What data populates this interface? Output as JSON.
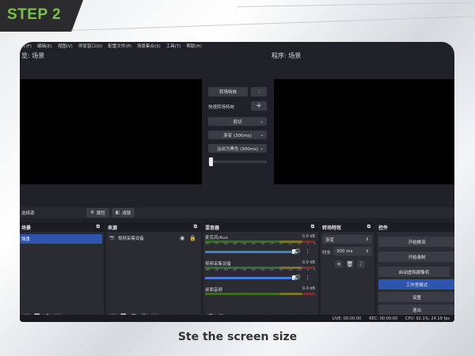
{
  "banner": {
    "step_label": "STEP 2"
  },
  "caption": "Ste the screen size",
  "colors": {
    "accent_green": "#7cc242",
    "selected_blue": "#2e54b0",
    "panel_dark": "#1f2028"
  },
  "app": {
    "menu": [
      "件(F)",
      "编辑(E)",
      "视图(V)",
      "停靠窗口(D)",
      "配置文件(P)",
      "场景集合(S)",
      "工具(T)",
      "帮助(H)"
    ],
    "preview_label": "览: 场景",
    "program_label": "程序: 场景",
    "transition": {
      "transition_button": "转场特效",
      "quick_label": "快速转场特效",
      "cut": "剪切",
      "fade": "渐变 (300ms)",
      "fade_black": "淡出为黑色 (300ms)"
    },
    "toolbar": {
      "no_source": "选择源",
      "properties": "属性",
      "filters": "滤镜"
    },
    "scenes": {
      "title": "场景",
      "items": [
        "场景"
      ]
    },
    "sources": {
      "title": "来源",
      "items": [
        "视频采集设备"
      ]
    },
    "mixer": {
      "title": "混音器",
      "channels": [
        {
          "name": "麦克风/Aux",
          "db": "0.0 dB"
        },
        {
          "name": "视频采集设备",
          "db": "0.0 dB"
        },
        {
          "name": "桌面音频",
          "db": "0.0 dB"
        }
      ],
      "scale": [
        "-60",
        "-55",
        "-50",
        "-45",
        "-40",
        "-35",
        "-30",
        "-25",
        "-20",
        "-15",
        "-10",
        "-5",
        "0"
      ]
    },
    "transitions": {
      "title": "转场特效",
      "selected": "渐变",
      "duration_label": "时长",
      "duration": "300 ms"
    },
    "controls": {
      "title": "控件",
      "buttons": [
        "开始推流",
        "开始录制",
        "启动虚拟摄像机",
        "工作室模式",
        "设置",
        "退出"
      ],
      "active_index": 3
    },
    "status": {
      "live": "LIVE: 00:00:00",
      "rec": "REC: 00:00:00",
      "cpu": "CPU: 92.1%, 24.19 fps"
    }
  }
}
